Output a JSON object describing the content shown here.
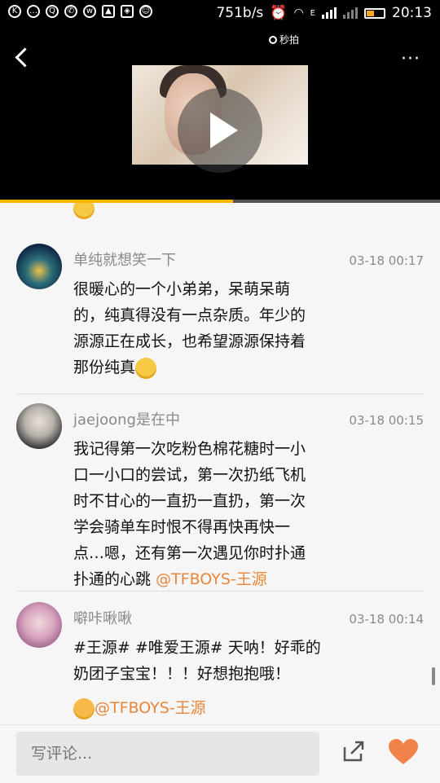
{
  "status_bar": {
    "speed": "751b/s",
    "network": "E",
    "time": "20:13"
  },
  "video": {
    "brand": "秒拍",
    "progress_fraction": 0.53,
    "accent_color": "#f7b500"
  },
  "comments": [
    {
      "name": "单纯就想笑一下",
      "time": "03-18 00:17",
      "text_lines": [
        "很暖心的一个小弟弟，呆萌呆萌",
        "的，纯真得没有一点杂质。年少的",
        "源源正在成长，也希望源源保持着",
        "那份纯真"
      ],
      "emoji": "smile-emoji"
    },
    {
      "name": "jaejoong是在中",
      "time": "03-18 00:15",
      "text_lines": [
        "我记得第一次吃粉色棉花糖时一小",
        "口一小口的尝试，第一次扔纸飞机",
        "时不甘心的一直扔一直扔，第一次",
        "学会骑单车时恨不得再快再快一",
        "点…嗯，还有第一次遇见你时扑通",
        "扑通的心跳"
      ],
      "mention": "@TFBOYS-王源"
    },
    {
      "name": "噼咔啾啾",
      "time": "03-18 00:14",
      "text_lines": [
        "#王源# #唯爱王源# 天呐！好乖的",
        "奶团子宝宝！！！好想抱抱哦！"
      ],
      "mention": "@TFBOYS-王源",
      "emoji": "kiss-emoji"
    }
  ],
  "bottom_bar": {
    "comment_placeholder": "写评论...",
    "heart_color": "#f0824a"
  }
}
